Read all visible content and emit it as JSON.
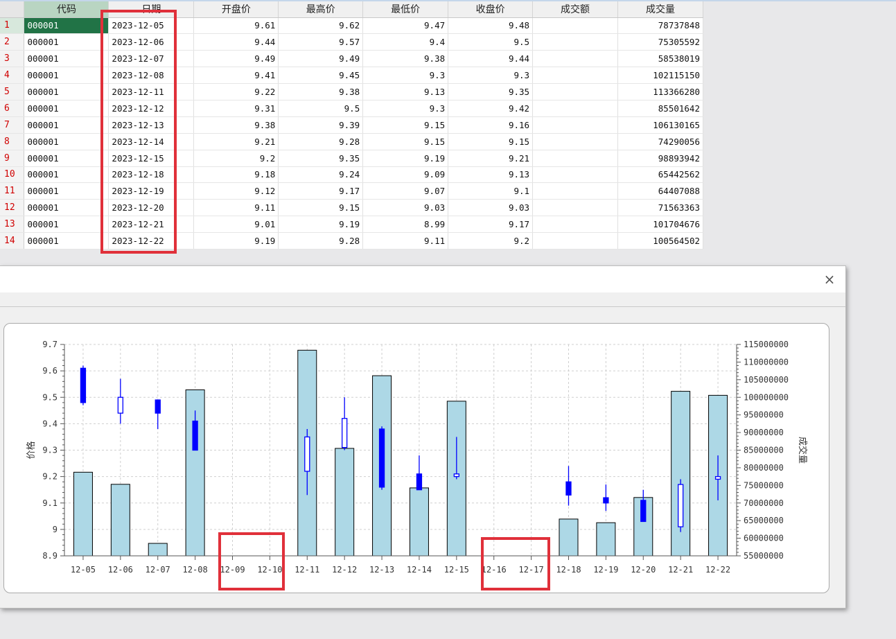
{
  "sheet": {
    "headers": [
      "代码",
      "日期",
      "开盘价",
      "最高价",
      "最低价",
      "收盘价",
      "成交额",
      "成交量"
    ],
    "rows": [
      {
        "n": "1",
        "code": "000001",
        "date": "2023-12-05",
        "open": "9.61",
        "high": "9.62",
        "low": "9.47",
        "close": "9.48",
        "amount": "",
        "volume": "78737848"
      },
      {
        "n": "2",
        "code": "000001",
        "date": "2023-12-06",
        "open": "9.44",
        "high": "9.57",
        "low": "9.4",
        "close": "9.5",
        "amount": "",
        "volume": "75305592"
      },
      {
        "n": "3",
        "code": "000001",
        "date": "2023-12-07",
        "open": "9.49",
        "high": "9.49",
        "low": "9.38",
        "close": "9.44",
        "amount": "",
        "volume": "58538019"
      },
      {
        "n": "4",
        "code": "000001",
        "date": "2023-12-08",
        "open": "9.41",
        "high": "9.45",
        "low": "9.3",
        "close": "9.3",
        "amount": "",
        "volume": "102115150"
      },
      {
        "n": "5",
        "code": "000001",
        "date": "2023-12-11",
        "open": "9.22",
        "high": "9.38",
        "low": "9.13",
        "close": "9.35",
        "amount": "",
        "volume": "113366280"
      },
      {
        "n": "6",
        "code": "000001",
        "date": "2023-12-12",
        "open": "9.31",
        "high": "9.5",
        "low": "9.3",
        "close": "9.42",
        "amount": "",
        "volume": "85501642"
      },
      {
        "n": "7",
        "code": "000001",
        "date": "2023-12-13",
        "open": "9.38",
        "high": "9.39",
        "low": "9.15",
        "close": "9.16",
        "amount": "",
        "volume": "106130165"
      },
      {
        "n": "8",
        "code": "000001",
        "date": "2023-12-14",
        "open": "9.21",
        "high": "9.28",
        "low": "9.15",
        "close": "9.15",
        "amount": "",
        "volume": "74290056"
      },
      {
        "n": "9",
        "code": "000001",
        "date": "2023-12-15",
        "open": "9.2",
        "high": "9.35",
        "low": "9.19",
        "close": "9.21",
        "amount": "",
        "volume": "98893942"
      },
      {
        "n": "10",
        "code": "000001",
        "date": "2023-12-18",
        "open": "9.18",
        "high": "9.24",
        "low": "9.09",
        "close": "9.13",
        "amount": "",
        "volume": "65442562"
      },
      {
        "n": "11",
        "code": "000001",
        "date": "2023-12-19",
        "open": "9.12",
        "high": "9.17",
        "low": "9.07",
        "close": "9.1",
        "amount": "",
        "volume": "64407088"
      },
      {
        "n": "12",
        "code": "000001",
        "date": "2023-12-20",
        "open": "9.11",
        "high": "9.15",
        "low": "9.03",
        "close": "9.03",
        "amount": "",
        "volume": "71563363"
      },
      {
        "n": "13",
        "code": "000001",
        "date": "2023-12-21",
        "open": "9.01",
        "high": "9.19",
        "low": "8.99",
        "close": "9.17",
        "amount": "",
        "volume": "101704676"
      },
      {
        "n": "14",
        "code": "000001",
        "date": "2023-12-22",
        "open": "9.19",
        "high": "9.28",
        "low": "9.11",
        "close": "9.2",
        "amount": "",
        "volume": "100564502"
      }
    ]
  },
  "dialog": {
    "close_icon": "close-icon",
    "close_glyph": "×"
  },
  "colors": {
    "candle": "#0000ff",
    "volume_bar": "#add8e6",
    "highlight_box": "#e0303a",
    "selected_cell": "#217346",
    "row_number": "#d00000"
  },
  "chart_data": {
    "type": "bar",
    "title": "",
    "xlabel": "",
    "ylabel": "价格",
    "y2label": "成交量",
    "categories": [
      "12-05",
      "12-06",
      "12-07",
      "12-08",
      "12-09",
      "12-10",
      "12-11",
      "12-12",
      "12-13",
      "12-14",
      "12-15",
      "12-16",
      "12-17",
      "12-18",
      "12-19",
      "12-20",
      "12-21",
      "12-22"
    ],
    "ylim": [
      8.9,
      9.7
    ],
    "y2lim": [
      55000000,
      115000000
    ],
    "yticks": [
      "8.9",
      "9",
      "9.1",
      "9.2",
      "9.3",
      "9.4",
      "9.5",
      "9.6",
      "9.7"
    ],
    "y2ticks": [
      "55000000",
      "60000000",
      "65000000",
      "70000000",
      "75000000",
      "80000000",
      "85000000",
      "90000000",
      "95000000",
      "100000000",
      "105000000",
      "110000000",
      "115000000"
    ],
    "grid": true,
    "series": [
      {
        "type": "candlestick",
        "ohlc": [
          [
            9.61,
            9.62,
            9.47,
            9.48
          ],
          [
            9.44,
            9.57,
            9.4,
            9.5
          ],
          [
            9.49,
            9.49,
            9.38,
            9.44
          ],
          [
            9.41,
            9.45,
            9.3,
            9.3
          ],
          null,
          null,
          [
            9.22,
            9.38,
            9.13,
            9.35
          ],
          [
            9.31,
            9.5,
            9.3,
            9.42
          ],
          [
            9.38,
            9.39,
            9.15,
            9.16
          ],
          [
            9.21,
            9.28,
            9.15,
            9.15
          ],
          [
            9.2,
            9.35,
            9.19,
            9.21
          ],
          null,
          null,
          [
            9.18,
            9.24,
            9.09,
            9.13
          ],
          [
            9.12,
            9.17,
            9.07,
            9.1
          ],
          [
            9.11,
            9.15,
            9.03,
            9.03
          ],
          [
            9.01,
            9.19,
            8.99,
            9.17
          ],
          [
            9.19,
            9.28,
            9.11,
            9.2
          ]
        ]
      },
      {
        "type": "bar",
        "axis": "right",
        "values": [
          78737848,
          75305592,
          58538019,
          102115150,
          null,
          null,
          113366280,
          85501642,
          106130165,
          74290056,
          98893942,
          null,
          null,
          65442562,
          64407088,
          71563363,
          101704676,
          100564502
        ]
      }
    ]
  }
}
